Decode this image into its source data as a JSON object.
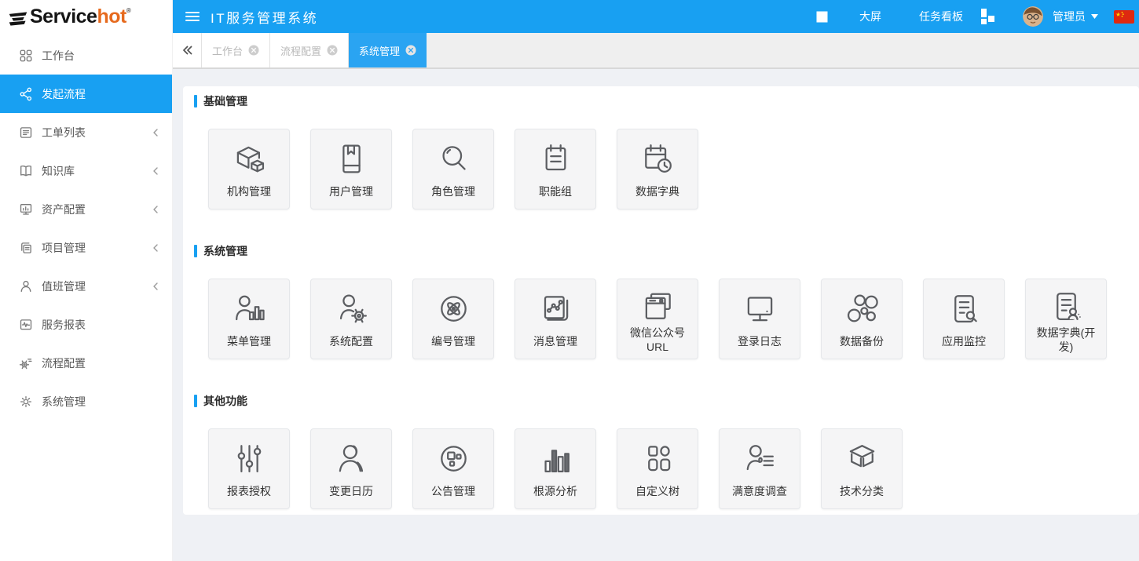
{
  "brand": {
    "name_black": "Service",
    "name_orange": "hot",
    "reg": "®"
  },
  "header": {
    "title": "IT服务管理系统",
    "big_screen": "大屏",
    "task_board": "任务看板",
    "username": "管理员"
  },
  "tabs": {
    "items": [
      {
        "label": "工作台",
        "active": false
      },
      {
        "label": "流程配置",
        "active": false
      },
      {
        "label": "系统管理",
        "active": true
      }
    ]
  },
  "sidebar": {
    "items": [
      {
        "label": "工作台",
        "icon": "grid-icon",
        "active": false,
        "expandable": false
      },
      {
        "label": "发起流程",
        "icon": "flow-start-icon",
        "active": true,
        "expandable": false
      },
      {
        "label": "工单列表",
        "icon": "work-order-icon",
        "active": false,
        "expandable": true
      },
      {
        "label": "知识库",
        "icon": "knowledge-base-icon",
        "active": false,
        "expandable": true
      },
      {
        "label": "资产配置",
        "icon": "asset-config-icon",
        "active": false,
        "expandable": true
      },
      {
        "label": "项目管理",
        "icon": "project-docs-icon",
        "active": false,
        "expandable": true
      },
      {
        "label": "值班管理",
        "icon": "duty-person-icon",
        "active": false,
        "expandable": true
      },
      {
        "label": "服务报表",
        "icon": "service-report-icon",
        "active": false,
        "expandable": false
      },
      {
        "label": "流程配置",
        "icon": "process-gear-icon",
        "active": false,
        "expandable": false
      },
      {
        "label": "系统管理",
        "icon": "system-gear-icon",
        "active": false,
        "expandable": false
      }
    ]
  },
  "sections": [
    {
      "title": "基础管理",
      "cards": [
        {
          "label": "机构管理",
          "icon": "org-cubes-icon"
        },
        {
          "label": "用户管理",
          "icon": "user-book-icon"
        },
        {
          "label": "角色管理",
          "icon": "role-magnifier-icon"
        },
        {
          "label": "职能组",
          "icon": "function-clipboard-icon"
        },
        {
          "label": "数据字典",
          "icon": "calendar-clock-icon"
        }
      ]
    },
    {
      "title": "系统管理",
      "cards": [
        {
          "label": "菜单管理",
          "icon": "person-bars-icon"
        },
        {
          "label": "系统配置",
          "icon": "person-gear-icon"
        },
        {
          "label": "编号管理",
          "icon": "atom-icon"
        },
        {
          "label": "消息管理",
          "icon": "message-chart-icon"
        },
        {
          "label": "微信公众号URL",
          "icon": "wechat-windows-icon"
        },
        {
          "label": "登录日志",
          "icon": "monitor-icon"
        },
        {
          "label": "数据备份",
          "icon": "backup-circles-icon"
        },
        {
          "label": "应用监控",
          "icon": "doc-magnifier-icon"
        },
        {
          "label": "数据字典(开发)",
          "icon": "doc-person-icon"
        }
      ]
    },
    {
      "title": "其他功能",
      "cards": [
        {
          "label": "报表授权",
          "icon": "sliders-icon"
        },
        {
          "label": "变更日历",
          "icon": "person-double-icon"
        },
        {
          "label": "公告管理",
          "icon": "circle-squares-icon"
        },
        {
          "label": "根源分析",
          "icon": "bar-chart-icon"
        },
        {
          "label": "自定义树",
          "icon": "four-squares-icon"
        },
        {
          "label": "满意度调查",
          "icon": "person-list-icon"
        },
        {
          "label": "技术分类",
          "icon": "cube-icon"
        }
      ]
    }
  ],
  "colors": {
    "primary": "#18A0F2",
    "tab_active": "#2AA4F2",
    "logo_orange": "#E66A1E",
    "content_bg": "#EFF1F5",
    "card_bg": "#F5F5F6",
    "flag_red": "#DE2910",
    "flag_yellow": "#FFDE00"
  }
}
